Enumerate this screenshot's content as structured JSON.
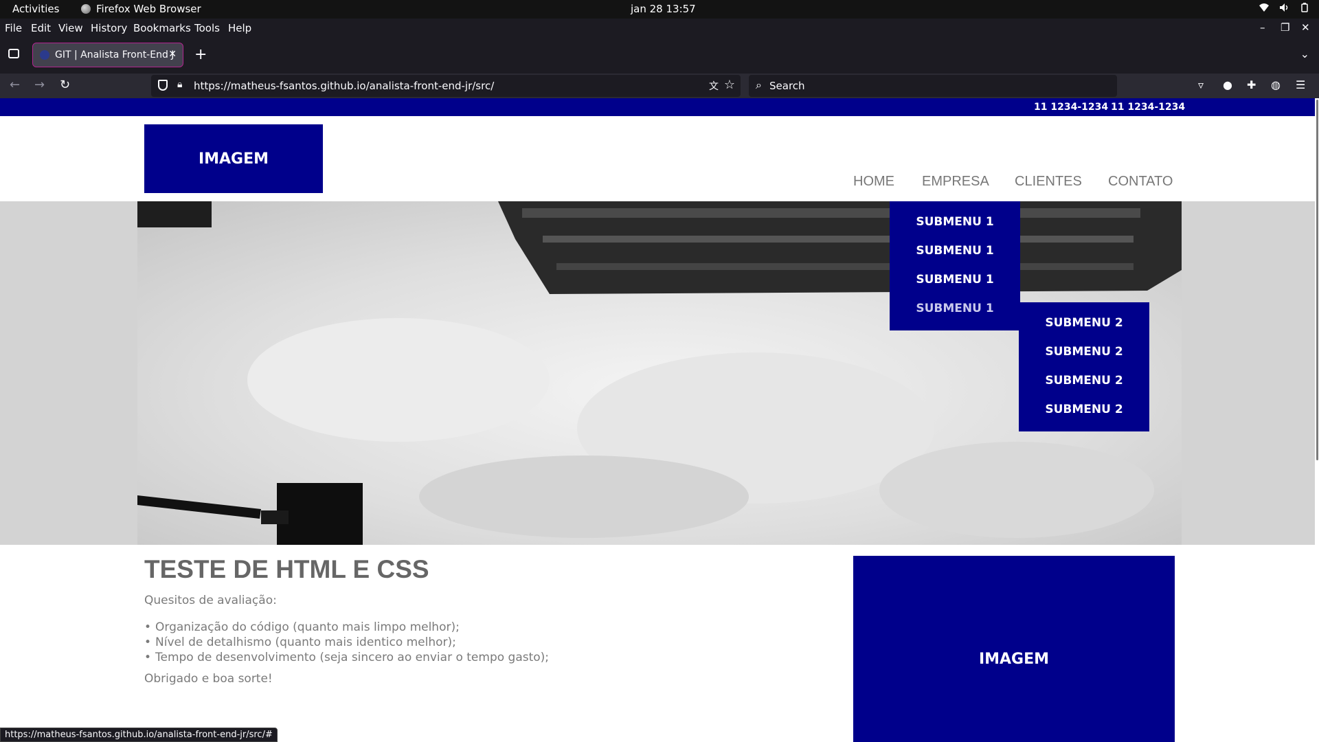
{
  "system_bar": {
    "activities": "Activities",
    "app_name": "Firefox Web Browser",
    "clock": "jan 28  13:57",
    "tray_icons": [
      "wifi-icon",
      "volume-icon",
      "power-icon"
    ]
  },
  "menu": {
    "items": [
      "File",
      "Edit",
      "View",
      "History",
      "Bookmarks",
      "Tools",
      "Help"
    ]
  },
  "tabs": [
    {
      "title": "GIT | Analista Front-End J",
      "active": true
    }
  ],
  "address_bar": {
    "url": "https://matheus-fsantos.github.io/analista-front-end-jr/src/",
    "search_placeholder": "Search"
  },
  "page": {
    "topline_phones": [
      "11 1234-1234",
      "11 1234-1234"
    ],
    "logo_text": "IMAGEM",
    "nav": [
      "HOME",
      "EMPRESA",
      "CLIENTES",
      "CONTATO"
    ],
    "submenu1": [
      "SUBMENU 1",
      "SUBMENU 1",
      "SUBMENU 1",
      "SUBMENU 1"
    ],
    "submenu2": [
      "SUBMENU 2",
      "SUBMENU 2",
      "SUBMENU 2",
      "SUBMENU 2"
    ],
    "title": "TESTE DE HTML E CSS",
    "lead": "Quesitos de avaliação:",
    "criteria": [
      "Organização do código (quanto mais limpo melhor);",
      "Nível de detalhismo (quanto mais identico melhor);",
      "Tempo de desenvolvimento (seja sincero ao enviar o tempo gasto);"
    ],
    "thanks": "Obrigado e boa sorte!",
    "side_image_text": "IMAGEM"
  },
  "status_url": "https://matheus-fsantos.github.io/analista-front-end-jr/src/#",
  "colors": {
    "brand_blue": "#00008b",
    "text_gray": "#7a7a7a",
    "hero_band": "#d3d3d3"
  }
}
